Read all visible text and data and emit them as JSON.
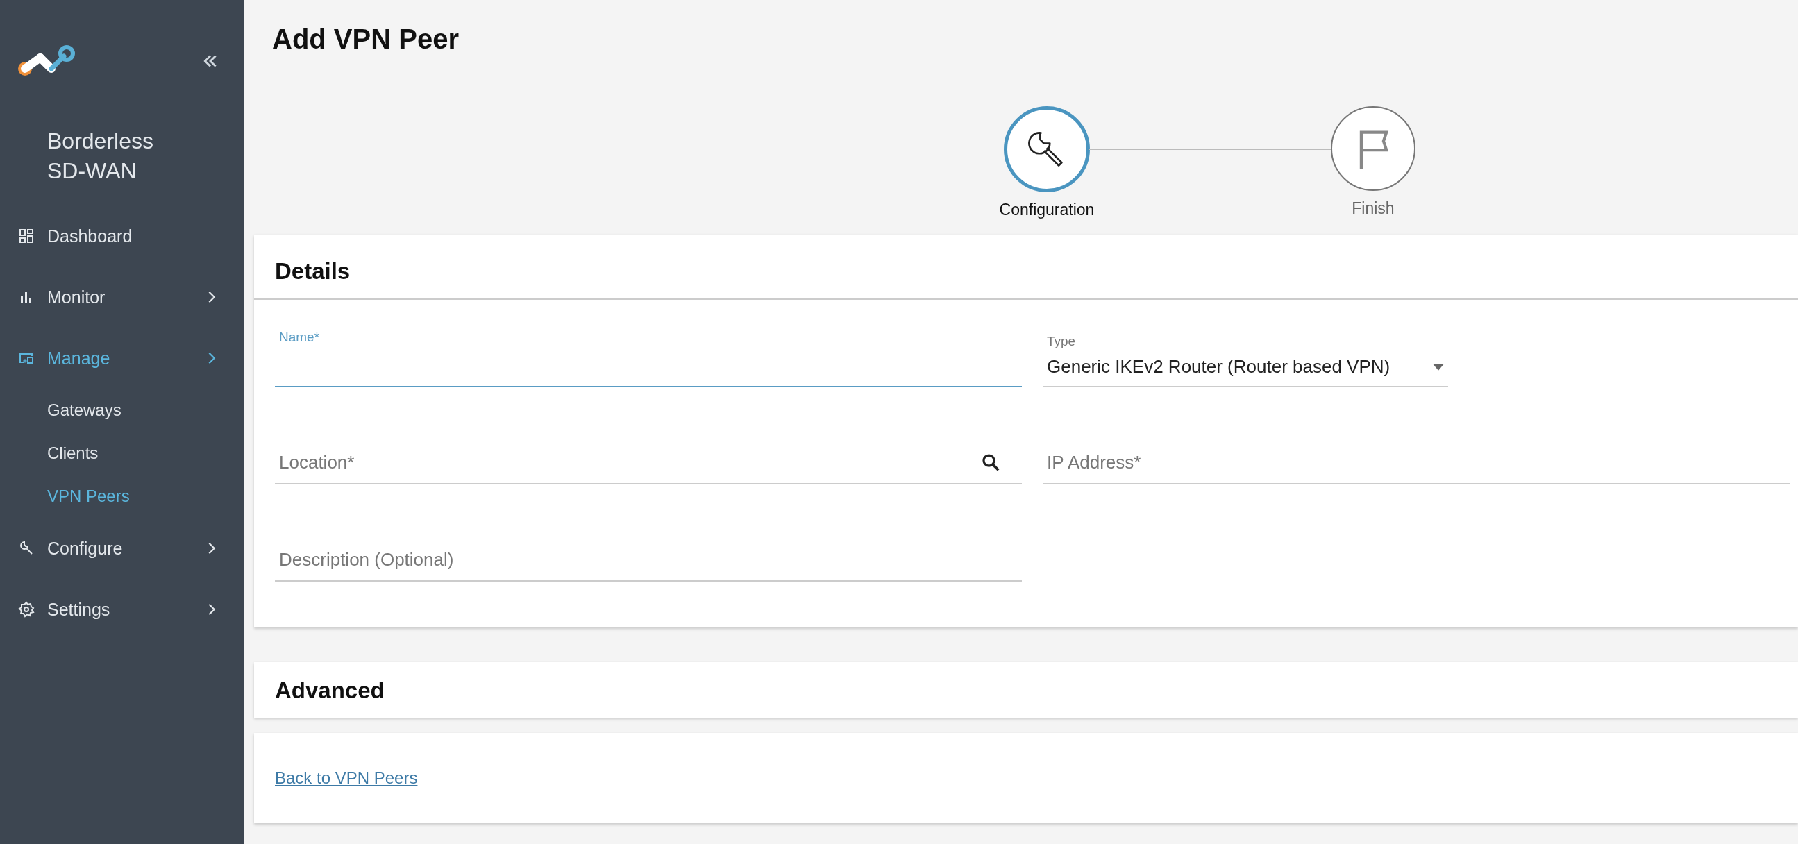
{
  "sidebar": {
    "brand": "Borderless SD-WAN",
    "items": [
      {
        "label": "Dashboard",
        "has_submenu": false,
        "selected": false
      },
      {
        "label": "Monitor",
        "has_submenu": true,
        "selected": false
      },
      {
        "label": "Manage",
        "has_submenu": true,
        "selected": true,
        "children": [
          {
            "label": "Gateways",
            "selected": false
          },
          {
            "label": "Clients",
            "selected": false
          },
          {
            "label": "VPN Peers",
            "selected": true
          }
        ]
      },
      {
        "label": "Configure",
        "has_submenu": true,
        "selected": false
      },
      {
        "label": "Settings",
        "has_submenu": true,
        "selected": false
      }
    ]
  },
  "page": {
    "title": "Add VPN Peer"
  },
  "steps": [
    {
      "label": "Configuration",
      "active": true
    },
    {
      "label": "Finish",
      "active": false
    }
  ],
  "details": {
    "title": "Details",
    "fields": [
      {
        "kind": "text",
        "label": "Name*",
        "focused": true
      },
      {
        "kind": "select",
        "label": "Type",
        "value": "Generic IKEv2 Router (Router based VPN)",
        "focused": false
      },
      {
        "kind": "search",
        "placeholder": "Location*",
        "focused": false
      },
      {
        "kind": "text",
        "placeholder": "IP Address*",
        "focused": false
      },
      {
        "kind": "text",
        "placeholder": "Description (Optional)",
        "focused": false
      }
    ]
  },
  "advanced": {
    "title": "Advanced"
  },
  "back_link": "Back to VPN Peers"
}
